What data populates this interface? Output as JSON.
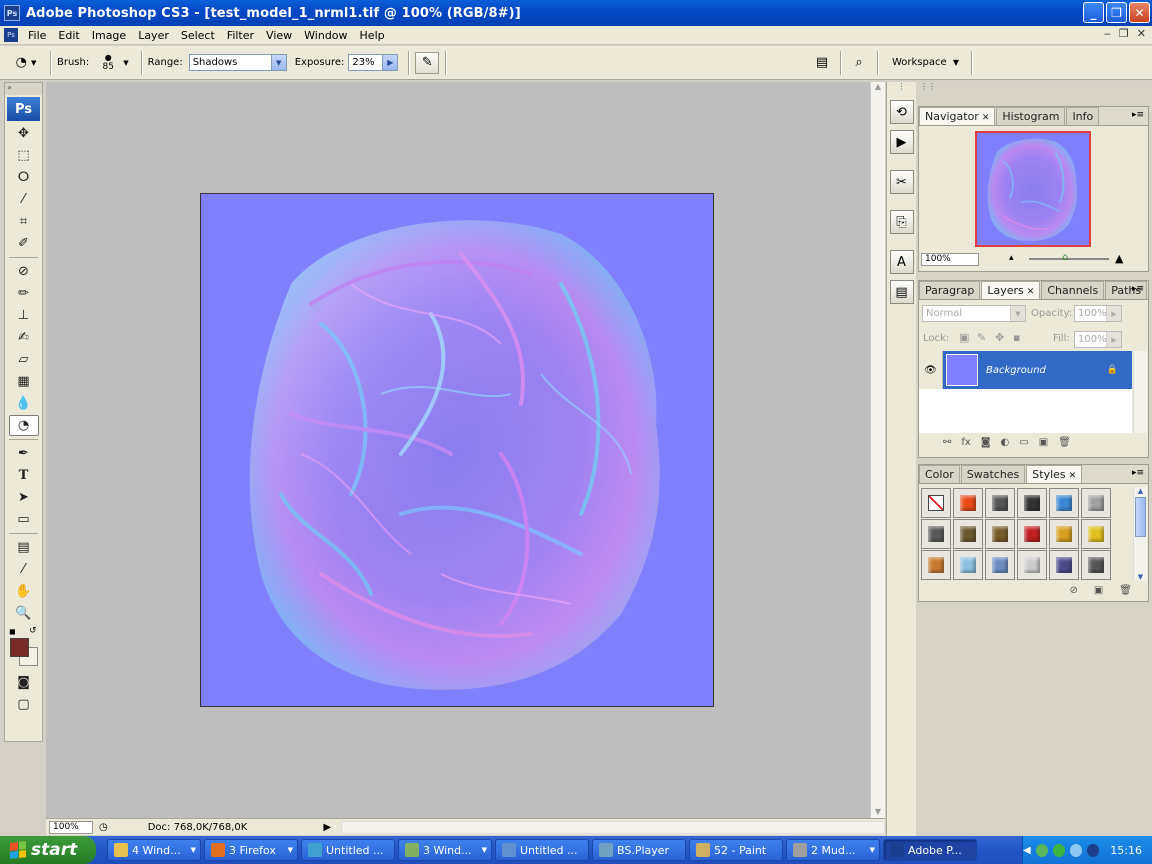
{
  "window": {
    "title": "Adobe Photoshop CS3 - [test_model_1_nrml1.tif @ 100% (RGB/8#)]",
    "app_icon": "Ps",
    "controls": [
      "minimize-icon",
      "restore-icon",
      "close-icon"
    ]
  },
  "menu": {
    "items": [
      "File",
      "Edit",
      "Image",
      "Layer",
      "Select",
      "Filter",
      "View",
      "Window",
      "Help"
    ]
  },
  "options": {
    "brush_label": "Brush:",
    "brush_size": "85",
    "range_label": "Range:",
    "range_value": "Shadows",
    "exposure_label": "Exposure:",
    "exposure_value": "23%",
    "workspace_label": "Workspace"
  },
  "toolbox": {
    "logo": "Ps",
    "tools": [
      "move-tool-icon",
      "marquee-tool-icon",
      "lasso-tool-icon",
      "magic-wand-icon",
      "crop-tool-icon",
      "slice-tool-icon",
      "healing-brush-icon",
      "brush-tool-icon",
      "clone-stamp-icon",
      "history-brush-icon",
      "eraser-icon",
      "gradient-tool-icon",
      "blur-tool-icon",
      "dodge-tool-icon",
      "pen-tool-icon",
      "type-tool-icon",
      "path-selection-icon",
      "shape-tool-icon",
      "notes-tool-icon",
      "eyedropper-icon",
      "hand-tool-icon",
      "zoom-tool-icon"
    ],
    "foreground_color": "#7b2a2a",
    "background_color": "#f5f0e6"
  },
  "status": {
    "zoom": "100%",
    "doc_info": "Doc: 768,0K/768,0K"
  },
  "navigator": {
    "tabs": [
      "Navigator",
      "Histogram",
      "Info"
    ],
    "zoom": "100%"
  },
  "layers_panel": {
    "tabs": [
      "Paragrap",
      "Layers",
      "Channels",
      "Paths"
    ],
    "blend_mode": "Normal",
    "opacity_label": "Opacity:",
    "opacity_value": "100%",
    "lock_label": "Lock:",
    "fill_label": "Fill:",
    "fill_value": "100%",
    "layers": [
      {
        "name": "Background",
        "visible": true,
        "locked": true
      }
    ]
  },
  "styles_panel": {
    "tabs": [
      "Color",
      "Swatches",
      "Styles"
    ],
    "swatch_colors": [
      "#ffffff",
      "#e84a1a",
      "#555555",
      "#333333",
      "#3b87d4",
      "#a0a0a0",
      "#5a5a5a",
      "#6b5a2e",
      "#7a5c2a",
      "#c02020",
      "#d8a020",
      "#e0c020",
      "#c87a30",
      "#8cc0e0",
      "#6a8cc0",
      "#cccccc",
      "#4a4a8a",
      "#555555"
    ]
  },
  "taskbar": {
    "start_label": "start",
    "items": [
      {
        "label": "4 Wind...",
        "color": "#e8c050"
      },
      {
        "label": "3 Firefox",
        "color": "#e07020"
      },
      {
        "label": "Untitled ...",
        "color": "#40a0d0"
      },
      {
        "label": "3 Wind...",
        "color": "#80b060"
      },
      {
        "label": "Untitled ...",
        "color": "#6090d0"
      },
      {
        "label": "BS.Player",
        "color": "#70a0c0"
      },
      {
        "label": "52 - Paint",
        "color": "#d0b060"
      },
      {
        "label": "2 Mud...",
        "color": "#a0a0a0"
      },
      {
        "label": "Adobe P...",
        "color": "#1a3f8f"
      }
    ],
    "clock": "15:16"
  },
  "colors": {
    "canvas_bg": "#8080ff",
    "layer_selected": "#3169c6",
    "xp_blue": "#2456c7"
  }
}
